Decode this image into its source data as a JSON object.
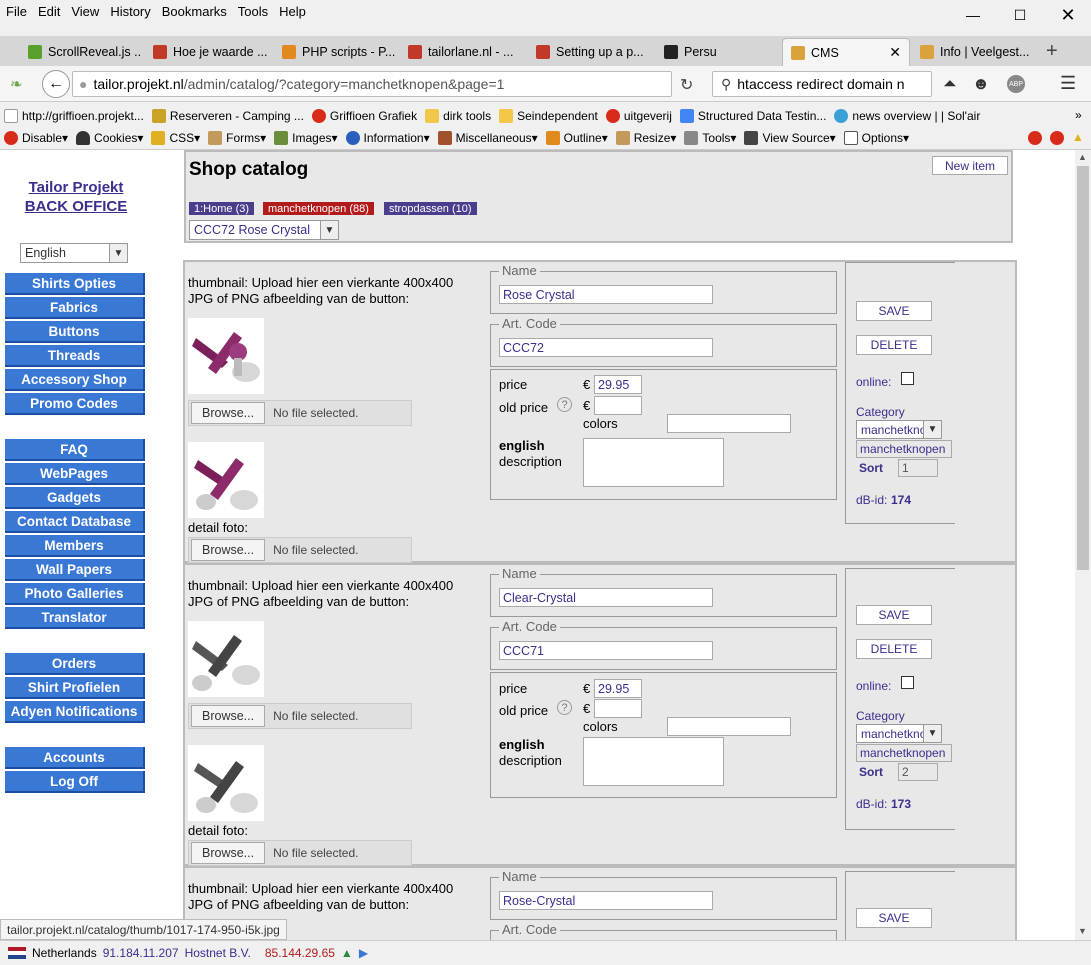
{
  "menu": [
    "File",
    "Edit",
    "View",
    "History",
    "Bookmarks",
    "Tools",
    "Help"
  ],
  "tabs": [
    {
      "title": "ScrollReveal.js ...",
      "color": "#5aa02c"
    },
    {
      "title": "Hoe je waarde ...",
      "color": "#c0392b"
    },
    {
      "title": "PHP scripts - P...",
      "color": "#e08a1e"
    },
    {
      "title": "tailorlane.nl - ...",
      "color": "#c0392b"
    },
    {
      "title": "Setting up a p...",
      "color": "#c0392b"
    },
    {
      "title": "Persu",
      "color": "#222222"
    },
    {
      "title": "CMS",
      "color": "#d9a23a"
    },
    {
      "title": "Info | Veelgest...",
      "color": "#d9a23a"
    }
  ],
  "nav": {
    "url_host": "tailor.projekt.nl",
    "url_path": "/admin/catalog/?category=manchetknopen&page=1",
    "search": "htaccess redirect domain n"
  },
  "bookmarks": [
    "http://griffioen.projekt...",
    "Reserveren - Camping ...",
    "Griffioen Grafiek",
    "dirk tools",
    "Seindependent",
    "uitgeverij",
    "Structured Data Testin...",
    "news overview | | Sol'air"
  ],
  "devtools": [
    "Disable▾",
    "Cookies▾",
    "CSS▾",
    "Forms▾",
    "Images▾",
    "Information▾",
    "Miscellaneous▾",
    "Outline▾",
    "Resize▾",
    "Tools▾",
    "View Source▾",
    "Options▾"
  ],
  "sidebar": {
    "title1": "Tailor Projekt",
    "title2": "BACK OFFICE",
    "language": "English",
    "group1": [
      "Shirts Opties",
      "Fabrics",
      "Buttons",
      "Threads",
      "Accessory Shop",
      "Promo Codes"
    ],
    "group2": [
      "FAQ",
      "WebPages",
      "Gadgets",
      "Contact Database",
      "Members",
      "Wall Papers",
      "Photo Galleries",
      "Translator"
    ],
    "group3": [
      "Orders",
      "Shirt Profielen",
      "Adyen Notifications"
    ],
    "group4": [
      "Accounts",
      "Log Off"
    ]
  },
  "header": {
    "title": "Shop catalog",
    "new_item": "New item",
    "cats": [
      {
        "label": "1:Home (3)",
        "color": "#4b3c8c"
      },
      {
        "label": "manchetknopen (88)",
        "color": "#b31b1b"
      },
      {
        "label": "stropdassen (10)",
        "color": "#4b3c8c"
      }
    ],
    "product_select": "CCC72 Rose Crystal"
  },
  "labels": {
    "thumb_text1": "thumbnail: Upload hier een vierkante 400x400",
    "thumb_text2": "JPG of PNG afbeelding van de button:",
    "browse": "Browse...",
    "no_file": "No file selected.",
    "detail": "detail foto:",
    "name": "Name",
    "art_code": "Art. Code",
    "price": "price",
    "old_price": "old price",
    "euro": "€",
    "colors": "colors",
    "english": "english",
    "description": "description",
    "save": "SAVE",
    "delete": "DELETE",
    "online": "online:",
    "category": "Category",
    "sort": "Sort",
    "dbid": "dB-id:",
    "help": "?"
  },
  "items": [
    {
      "name": "Rose Crystal",
      "code": "CCC72",
      "price": "29.95",
      "cat": "manchetkno",
      "cat2": "manchetknopen",
      "sort": "1",
      "dbid": "174"
    },
    {
      "name": "Clear-Crystal",
      "code": "CCC71",
      "price": "29.95",
      "cat": "manchetkno",
      "cat2": "manchetknopen",
      "sort": "2",
      "dbid": "173"
    },
    {
      "name": "Rose-Crystal"
    }
  ],
  "status": {
    "tip": "tailor.projekt.nl/catalog/thumb/1017-174-950-i5k.jpg",
    "country": "Netherlands",
    "ip1": "91.184.11.207",
    "host": "Hostnet B.V.",
    "ip2": "85.144.29.65"
  }
}
